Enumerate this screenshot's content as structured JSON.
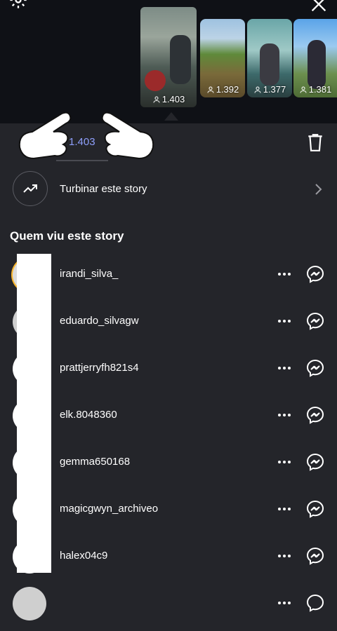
{
  "header": {
    "settings_icon": "gear-icon",
    "close_icon": "close-icon"
  },
  "stories": [
    {
      "views": "1.403",
      "selected": true
    },
    {
      "views": "1.392",
      "selected": false
    },
    {
      "views": "1.377",
      "selected": false
    },
    {
      "views": "1.381",
      "selected": false
    }
  ],
  "summary": {
    "views_count": "1.403"
  },
  "promote": {
    "label": "Turbinar este story"
  },
  "viewers": {
    "title": "Quem viu este story",
    "items": [
      {
        "username": "irandi_silva_"
      },
      {
        "username": "eduardo_silvagw"
      },
      {
        "username": "prattjerryfh821s4"
      },
      {
        "username": "elk.8048360"
      },
      {
        "username": "gemma650168"
      },
      {
        "username": "magicgwyn_archiveo"
      },
      {
        "username": "halex04c9"
      }
    ]
  },
  "colors": {
    "background": "#24252a",
    "top_bar": "#0f1116",
    "accent_count": "#8e9ffb",
    "ring": "#f7b42c"
  }
}
